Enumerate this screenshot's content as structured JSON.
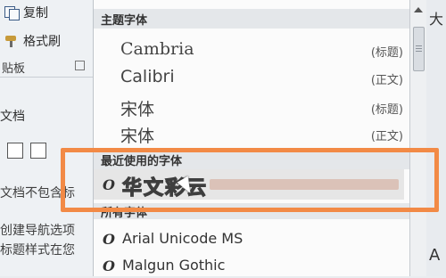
{
  "ribbon": {
    "copy_label": "复制",
    "format_painter_label": "格式刷",
    "clipboard_group_label": "贴板"
  },
  "nav_pane": {
    "title": "文档",
    "line1": "文档不包含标",
    "line2": "创建导航选项",
    "line3": "标题样式在您"
  },
  "dropdown": {
    "theme_header": "主题字体",
    "theme_fonts": [
      {
        "name": "Cambria",
        "tag": "(标题)"
      },
      {
        "name": "Calibri",
        "tag": "(正文)"
      },
      {
        "name": "宋体",
        "tag": "(标题)"
      },
      {
        "name": "宋体",
        "tag": "(正文)"
      }
    ],
    "recent_header": "最近使用的字体",
    "recent_font": {
      "name": "华文彩云"
    },
    "all_header": "所有字体",
    "all_fonts": [
      {
        "name": "Arial Unicode MS"
      },
      {
        "name": "Malgun Gothic"
      }
    ],
    "font_type_glyph": "O"
  },
  "right_edge": {
    "top_glyph": "大",
    "bottom_glyph": "A"
  },
  "colors": {
    "highlight_box": "#f28a46"
  }
}
